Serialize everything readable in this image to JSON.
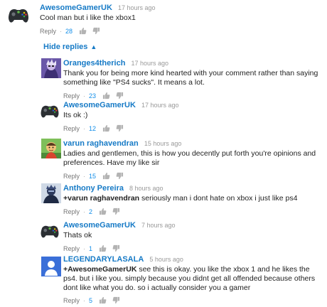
{
  "top_comment": {
    "author": "AwesomeGamerUK",
    "time": "17 hours ago",
    "text": "Cool man but i like the xbox1",
    "reply_label": "Reply",
    "likes": "28",
    "avatar_icon": "xbox-controller-icon"
  },
  "hide_replies_label": "Hide replies",
  "replies": [
    {
      "author": "Oranges4therich",
      "time": "17 hours ago",
      "text": "Thank you for being more kind hearted with your comment rather than saying something like \"PS4 sucks\". It means a lot.",
      "reply_label": "Reply",
      "likes": "23",
      "avatar_icon": "purple-anime-avatar-icon"
    },
    {
      "author": "AwesomeGamerUK",
      "time": "17 hours ago",
      "text": "Its ok :)",
      "reply_label": "Reply",
      "likes": "12",
      "avatar_icon": "xbox-controller-icon"
    },
    {
      "author": "varun raghavendran",
      "time": "15 hours ago",
      "text": "Ladies and gentlemen, this is how you decently put forth you're opinions and preferences. Have my like sir",
      "reply_label": "Reply",
      "likes": "15",
      "avatar_icon": "cartoon-avatar-icon"
    },
    {
      "author": "Anthony Pereira",
      "time": "8 hours ago",
      "mention": "+varun raghavendran",
      "text": " seriously man i dont hate on xbox i just like ps4",
      "reply_label": "Reply",
      "likes": "2",
      "avatar_icon": "dark-figure-avatar-icon"
    },
    {
      "author": "AwesomeGamerUK",
      "time": "7 hours ago",
      "text": "Thats ok",
      "reply_label": "Reply",
      "likes": "1",
      "avatar_icon": "xbox-controller-icon"
    },
    {
      "author": "LEGENDARYLASALA",
      "time": "5 hours ago",
      "mention": "+AwesomeGamerUK",
      "text": " see this is okay. you like the xbox 1 and he likes the ps4. but i like you. simply because you didnt get all offended because others dont like what you do. so i actually consider you a gamer",
      "reply_label": "Reply",
      "likes": "5",
      "avatar_icon": "default-user-avatar-icon"
    }
  ],
  "colors": {
    "author": "#167ac6",
    "like_count": "#128ee9",
    "meta": "#999999",
    "default_avatar": "#3a6fd8"
  }
}
